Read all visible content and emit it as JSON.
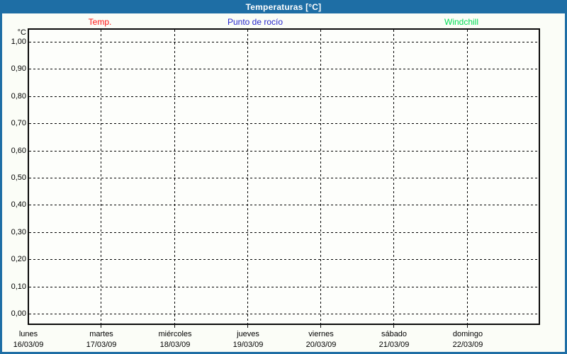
{
  "title_bar": {
    "title": "Temperaturas [°C]"
  },
  "legend": {
    "items": [
      {
        "label": "Temp.",
        "color": "#ff1414"
      },
      {
        "label": "Punto de rocío",
        "color": "#2626cc"
      },
      {
        "label": "Windchill",
        "color": "#00dd55"
      }
    ]
  },
  "chart_data": {
    "type": "line",
    "title": "Temperaturas [°C]",
    "ylabel": "°C",
    "ylim": [
      0.0,
      1.0
    ],
    "y_tick_labels": [
      "1,00",
      "0,90",
      "0,80",
      "0,70",
      "0,60",
      "0,50",
      "0,40",
      "0,30",
      "0,20",
      "0,10",
      "0,00"
    ],
    "y_tick_values": [
      1.0,
      0.9,
      0.8,
      0.7,
      0.6,
      0.5,
      0.4,
      0.3,
      0.2,
      0.1,
      0.0
    ],
    "x_days": [
      {
        "name": "lunes",
        "date": "16/03/09"
      },
      {
        "name": "martes",
        "date": "17/03/09"
      },
      {
        "name": "miércoles",
        "date": "18/03/09"
      },
      {
        "name": "jueves",
        "date": "19/03/09"
      },
      {
        "name": "viernes",
        "date": "20/03/09"
      },
      {
        "name": "sábado",
        "date": "21/03/09"
      },
      {
        "name": "domingo",
        "date": "22/03/09"
      }
    ],
    "series": [
      {
        "name": "Temp.",
        "color": "#ff1414",
        "values": []
      },
      {
        "name": "Punto de rocío",
        "color": "#2626cc",
        "values": []
      },
      {
        "name": "Windchill",
        "color": "#00dd55",
        "values": []
      }
    ],
    "grid": {
      "style": "dashed",
      "horizontal_step": 0.1,
      "vertical": "day boundaries"
    },
    "legend_position": "top",
    "plotted_points": 0
  }
}
